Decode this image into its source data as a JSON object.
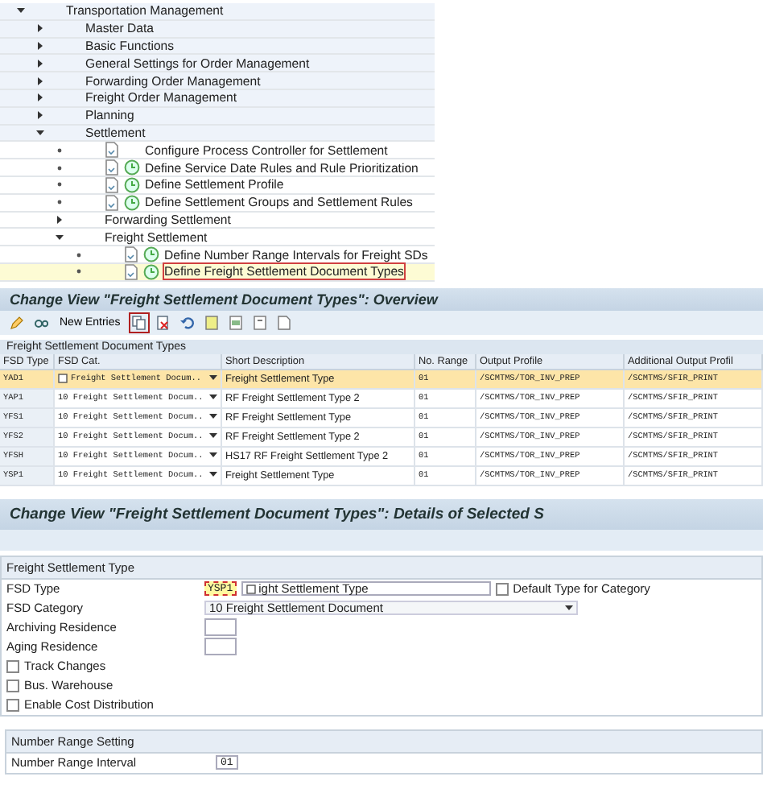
{
  "tree": [
    {
      "label": "Transportation Management",
      "kind": "folder",
      "expanded": true,
      "children": [
        {
          "label": "Master Data",
          "kind": "folder",
          "expanded": false
        },
        {
          "label": "Basic Functions",
          "kind": "folder",
          "expanded": false
        },
        {
          "label": "General Settings for Order Management",
          "kind": "folder",
          "expanded": false
        },
        {
          "label": "Forwarding Order Management",
          "kind": "folder",
          "expanded": false
        },
        {
          "label": "Freight Order Management",
          "kind": "folder",
          "expanded": false
        },
        {
          "label": "Planning",
          "kind": "folder",
          "expanded": false
        },
        {
          "label": "Settlement",
          "kind": "folder",
          "expanded": true,
          "children": [
            {
              "label": "Configure Process Controller for Settlement",
              "kind": "activity",
              "execute_icon": false,
              "selected": false
            },
            {
              "label": "Define Service Date Rules and Rule Prioritization",
              "kind": "activity",
              "execute_icon": true,
              "selected": false
            },
            {
              "label": "Define Settlement Profile",
              "kind": "activity",
              "execute_icon": true,
              "selected": false
            },
            {
              "label": "Define Settlement Groups and Settlement Rules",
              "kind": "activity",
              "execute_icon": true,
              "selected": false
            },
            {
              "label": "Forwarding Settlement",
              "kind": "folder",
              "expanded": false
            },
            {
              "label": "Freight Settlement",
              "kind": "folder",
              "expanded": true,
              "children": [
                {
                  "label": "Define Number Range Intervals for Freight SDs",
                  "kind": "activity",
                  "execute_icon": true,
                  "selected": false
                },
                {
                  "label": "Define Freight Settlement Document Types",
                  "kind": "activity",
                  "execute_icon": true,
                  "selected": true
                }
              ]
            }
          ]
        }
      ]
    }
  ],
  "overview": {
    "title": "Change View \"Freight Settlement Document Types\": Overview",
    "toolbar": [
      {
        "kind": "pencil",
        "highlighted": false
      },
      {
        "kind": "glasses",
        "highlighted": false
      },
      {
        "kind": "text",
        "label": "New Entries",
        "highlighted": false
      },
      {
        "kind": "copy",
        "highlighted": true
      },
      {
        "kind": "delete",
        "highlighted": false
      },
      {
        "kind": "undo",
        "highlighted": false
      },
      {
        "kind": "select-all",
        "highlighted": false
      },
      {
        "kind": "select-block",
        "highlighted": false
      },
      {
        "kind": "deselect",
        "highlighted": false
      },
      {
        "kind": "document",
        "highlighted": false
      }
    ],
    "table": {
      "title": "Freight Settlement Document Types",
      "columns": [
        "FSD Type",
        "FSD Cat.",
        "Short Description",
        "No. Range",
        "Output Profile",
        "Additional Output Profil"
      ],
      "rows": [
        {
          "selected": true,
          "cells": [
            "YAD1",
            "Freight Settlement Docum..",
            "Freight Settlement Type",
            "01",
            "/SCMTMS/TOR_INV_PREP",
            "/SCMTMS/SFIR_PRINT"
          ]
        },
        {
          "selected": false,
          "cells": [
            "YAP1",
            "10 Freight Settlement Docum..",
            "RF Freight Settlement Type 2",
            "01",
            "/SCMTMS/TOR_INV_PREP",
            "/SCMTMS/SFIR_PRINT"
          ]
        },
        {
          "selected": false,
          "cells": [
            "YFS1",
            "10 Freight Settlement Docum..",
            "RF Freight Settlement Type",
            "01",
            "/SCMTMS/TOR_INV_PREP",
            "/SCMTMS/SFIR_PRINT"
          ]
        },
        {
          "selected": false,
          "cells": [
            "YFS2",
            "10 Freight Settlement Docum..",
            "RF Freight Settlement Type 2",
            "01",
            "/SCMTMS/TOR_INV_PREP",
            "/SCMTMS/SFIR_PRINT"
          ]
        },
        {
          "selected": false,
          "cells": [
            "YFSH",
            "10 Freight Settlement Docum..",
            "HS17 RF Freight Settlement Type 2",
            "01",
            "/SCMTMS/TOR_INV_PREP",
            "/SCMTMS/SFIR_PRINT"
          ]
        },
        {
          "selected": false,
          "cells": [
            "YSP1",
            "10 Freight Settlement Docum..",
            "Freight Settlement Type",
            "01",
            "/SCMTMS/TOR_INV_PREP",
            "/SCMTMS/SFIR_PRINT"
          ]
        }
      ]
    }
  },
  "details": {
    "title": "Change View \"Freight Settlement Document Types\": Details of Selected S",
    "group_title": "Freight Settlement Type",
    "fsd_type": {
      "label": "FSD Type",
      "value": "YSP1",
      "description": "ight Settlement Type",
      "default_label": "Default Type for Category",
      "default_checked": false
    },
    "fsd_category": {
      "label": "FSD Category",
      "value": "10 Freight Settlement Document"
    },
    "archiving": {
      "label": "Archiving Residence"
    },
    "aging": {
      "label": "Aging Residence"
    },
    "checkboxes": [
      {
        "label": "Track Changes",
        "checked": false
      },
      {
        "label": "Bus. Warehouse",
        "checked": false
      },
      {
        "label": "Enable Cost Distribution",
        "checked": false
      }
    ],
    "number_range": {
      "title": "Number Range Setting",
      "label": "Number Range Interval",
      "value": "01"
    }
  }
}
